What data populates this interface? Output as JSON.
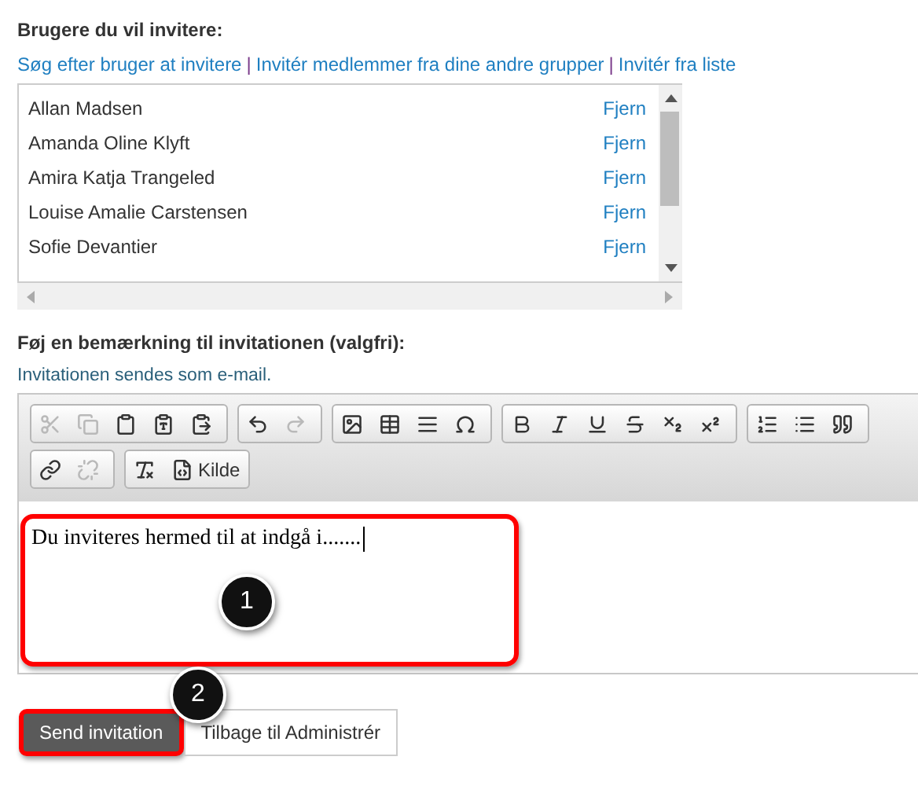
{
  "invite_title": "Brugere du vil invitere:",
  "invite_links": [
    "Søg efter bruger at invitere",
    "Invitér medlemmer fra dine andre grupper",
    "Invitér fra liste"
  ],
  "invitees": [
    {
      "name": "Allan Madsen",
      "action": "Fjern"
    },
    {
      "name": "Amanda Oline Klyft",
      "action": "Fjern"
    },
    {
      "name": "Amira Katja Trangeled",
      "action": "Fjern"
    },
    {
      "name": "Louise Amalie Carstensen",
      "action": "Fjern"
    },
    {
      "name": "Sofie Devantier",
      "action": "Fjern"
    }
  ],
  "link_separator": "|",
  "note_label": "Føj en bemærkning til invitationen (valgfri):",
  "note_hint": "Invitationen sendes som e-mail.",
  "toolbar": [
    [
      {
        "kind": "cut",
        "disabled": true
      },
      {
        "kind": "copy",
        "disabled": true
      },
      {
        "kind": "paste",
        "disabled": false
      },
      {
        "kind": "paste-text",
        "disabled": false
      },
      {
        "kind": "paste-word",
        "disabled": false
      }
    ],
    [
      {
        "kind": "undo",
        "disabled": false
      },
      {
        "kind": "redo",
        "disabled": true
      }
    ],
    [
      {
        "kind": "image",
        "disabled": false
      },
      {
        "kind": "table",
        "disabled": false
      },
      {
        "kind": "rule",
        "disabled": false
      },
      {
        "kind": "symbol",
        "disabled": false
      }
    ],
    [
      {
        "kind": "bold",
        "disabled": false
      },
      {
        "kind": "italic",
        "disabled": false
      },
      {
        "kind": "underline",
        "disabled": false
      },
      {
        "kind": "strike",
        "disabled": false
      },
      {
        "kind": "subscript",
        "disabled": false
      },
      {
        "kind": "superscript",
        "disabled": false
      }
    ],
    [
      {
        "kind": "numbered-list",
        "disabled": false
      },
      {
        "kind": "bullet-list",
        "disabled": false
      },
      {
        "kind": "quote",
        "disabled": false
      }
    ],
    [
      {
        "kind": "link",
        "disabled": false
      },
      {
        "kind": "unlink",
        "disabled": true
      }
    ],
    [
      {
        "kind": "clear-format",
        "disabled": false
      },
      {
        "kind": "source",
        "disabled": false,
        "label": "Kilde"
      }
    ]
  ],
  "editor_text": "Du inviteres hermed til at indgå i.......",
  "buttons": [
    {
      "label": "Send invitation",
      "kind": "primary",
      "highlighted": true
    },
    {
      "label": "Tilbage til Administrér",
      "kind": "secondary",
      "highlighted": false
    }
  ],
  "callouts": [
    "1",
    "2"
  ]
}
